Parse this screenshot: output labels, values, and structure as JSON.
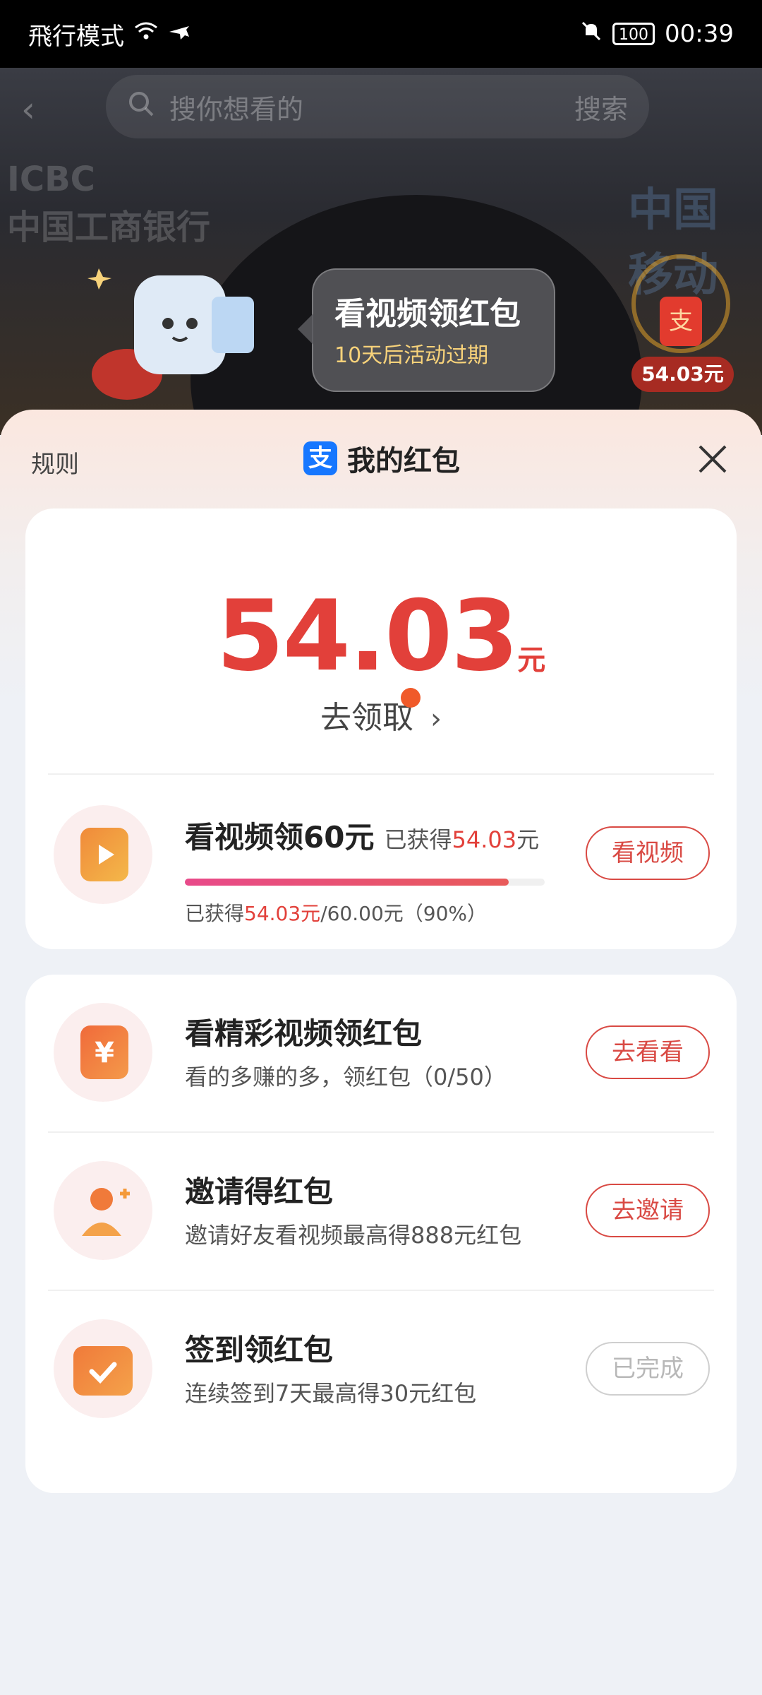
{
  "status": {
    "mode": "飛行模式",
    "battery": "100",
    "time": "00:39"
  },
  "background": {
    "search_placeholder": "搜你想看的",
    "search_btn": "搜索",
    "sign_left": "中国工商银行",
    "sign_left_abbr": "ICBC",
    "sign_right": "中国移动"
  },
  "bubble": {
    "title": "看视频领红包",
    "subtitle": "10天后活动过期"
  },
  "float_badge": {
    "icon": "支",
    "amount": "54.03元"
  },
  "sheet": {
    "rules": "规则",
    "brand_icon": "支",
    "title": "我的红包"
  },
  "balance": {
    "amount": "54.03",
    "unit": "元",
    "claim": "去领取"
  },
  "video_task": {
    "title": "看视频领60元",
    "obtained_prefix": "已获得",
    "obtained_value": "54.03",
    "obtained_suffix": "元",
    "progress_prefix": "已获得",
    "progress_value": "54.03元",
    "progress_rest": "/60.00元（90%）",
    "progress_fraction": 0.9,
    "button": "看视频"
  },
  "tasks": [
    {
      "title": "看精彩视频领红包",
      "subtitle": "看的多赚的多，领红包（0/50）",
      "button": "去看看",
      "icon": "yuan-icon"
    },
    {
      "title": "邀请得红包",
      "subtitle": "邀请好友看视频最高得888元红包",
      "button": "去邀请",
      "icon": "add-user-icon"
    },
    {
      "title": "签到领红包",
      "subtitle": "连续签到7天最高得30元红包",
      "button": "已完成",
      "icon": "calendar-check-icon"
    }
  ],
  "colors": {
    "accent": "#e2403a",
    "brand": "#1677ff"
  }
}
